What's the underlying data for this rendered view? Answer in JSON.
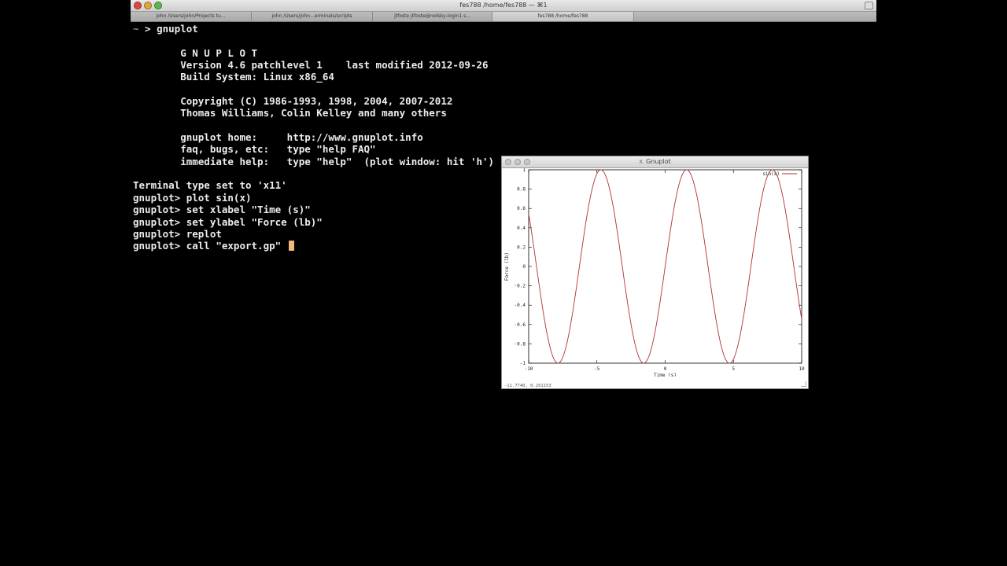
{
  "window": {
    "title": "fes788 /home/fes788 — ⌘1",
    "tabs": [
      "john /Users/john/Projects      tu...",
      "john /Users/john...erminals/scripts",
      "jtfoste jtfoste@redsky-login1      s...",
      "fes788 /home/fes788"
    ]
  },
  "terminal": {
    "lines": [
      "~ > gnuplot",
      "",
      "        G N U P L O T",
      "        Version 4.6 patchlevel 1    last modified 2012-09-26",
      "        Build System: Linux x86_64",
      "",
      "        Copyright (C) 1986-1993, 1998, 2004, 2007-2012",
      "        Thomas Williams, Colin Kelley and many others",
      "",
      "        gnuplot home:     http://www.gnuplot.info",
      "        faq, bugs, etc:   type \"help FAQ\"",
      "        immediate help:   type \"help\"  (plot window: hit 'h')",
      "",
      "Terminal type set to 'x11'",
      "gnuplot> plot sin(x)",
      "gnuplot> set xlabel \"Time (s)\"",
      "gnuplot> set ylabel \"Force (lb)\"",
      "gnuplot> replot",
      "gnuplot> call \"export.gp\" "
    ],
    "cursor_color": "#f3b880"
  },
  "gnuplot_window": {
    "title": "Gnuplot",
    "x_icon": "X",
    "status": "-11.7740,  0.291153"
  },
  "chart_data": {
    "type": "line",
    "function": "sin(x)",
    "xlabel": "Time (s)",
    "ylabel": "Force (lb)",
    "xlim": [
      -10,
      10
    ],
    "ylim": [
      -1,
      1
    ],
    "xticks": [
      -10,
      -5,
      0,
      5,
      10
    ],
    "yticks": [
      -1,
      -0.8,
      -0.6,
      -0.4,
      -0.2,
      0,
      0.2,
      0.4,
      0.6,
      0.8,
      1
    ],
    "legend": "top-right",
    "grid": false,
    "series": [
      {
        "name": "sin(x)",
        "color": "#b03030",
        "samples": 100
      }
    ]
  }
}
